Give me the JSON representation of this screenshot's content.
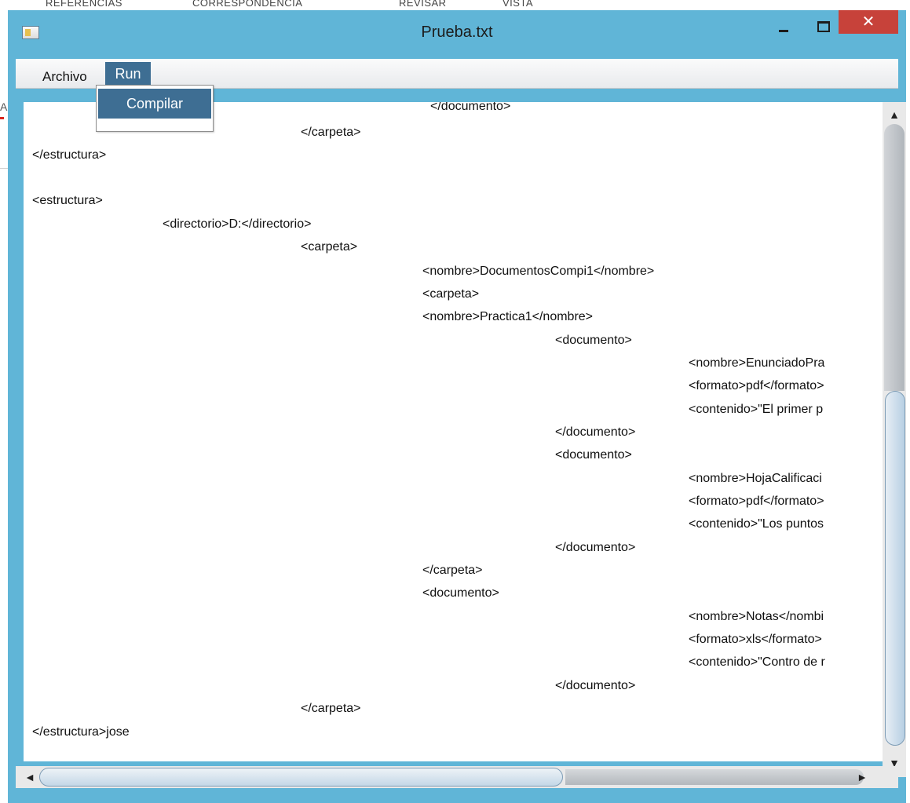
{
  "background": {
    "ribbon_tabs": [
      "REFERENCIAS",
      "CORRESPONDENCIA",
      "REVISAR",
      "VISTA"
    ],
    "side_letter": "A"
  },
  "window": {
    "title": "Prueba.txt",
    "close_glyph": "✕"
  },
  "menubar": {
    "archivo_label": "Archivo",
    "run_label": "Run"
  },
  "dropdown": {
    "compilar_label": "Compilar"
  },
  "editor": {
    "lines": [
      "</documento>",
      "</carpeta>",
      "</estructura>",
      "<estructura>",
      "<directorio>D:</directorio>",
      "<carpeta>",
      "<nombre>DocumentosCompi1</nombre>",
      "<carpeta>",
      "<nombre>Practica1</nombre>",
      "<documento>",
      "<nombre>EnunciadoPra",
      "<formato>pdf</formato>",
      "<contenido>\"El primer p",
      "</documento>",
      "<documento>",
      "<nombre>HojaCalificaci",
      "<formato>pdf</formato>",
      "<contenido>\"Los puntos",
      "</documento>",
      "</carpeta>",
      "<documento>",
      "<nombre>Notas</nombi",
      "<formato>xls</formato>",
      "<contenido>\"Contro de r",
      "</documento>",
      "</carpeta>",
      "</estructura>jose"
    ]
  },
  "scrollbars": {
    "up_glyph": "▲",
    "down_glyph": "▼",
    "left_glyph": "◄",
    "right_glyph": "►"
  },
  "colors": {
    "window_frame": "#60b5d7",
    "selection": "#3e6e93",
    "close_button": "#c7423a"
  }
}
